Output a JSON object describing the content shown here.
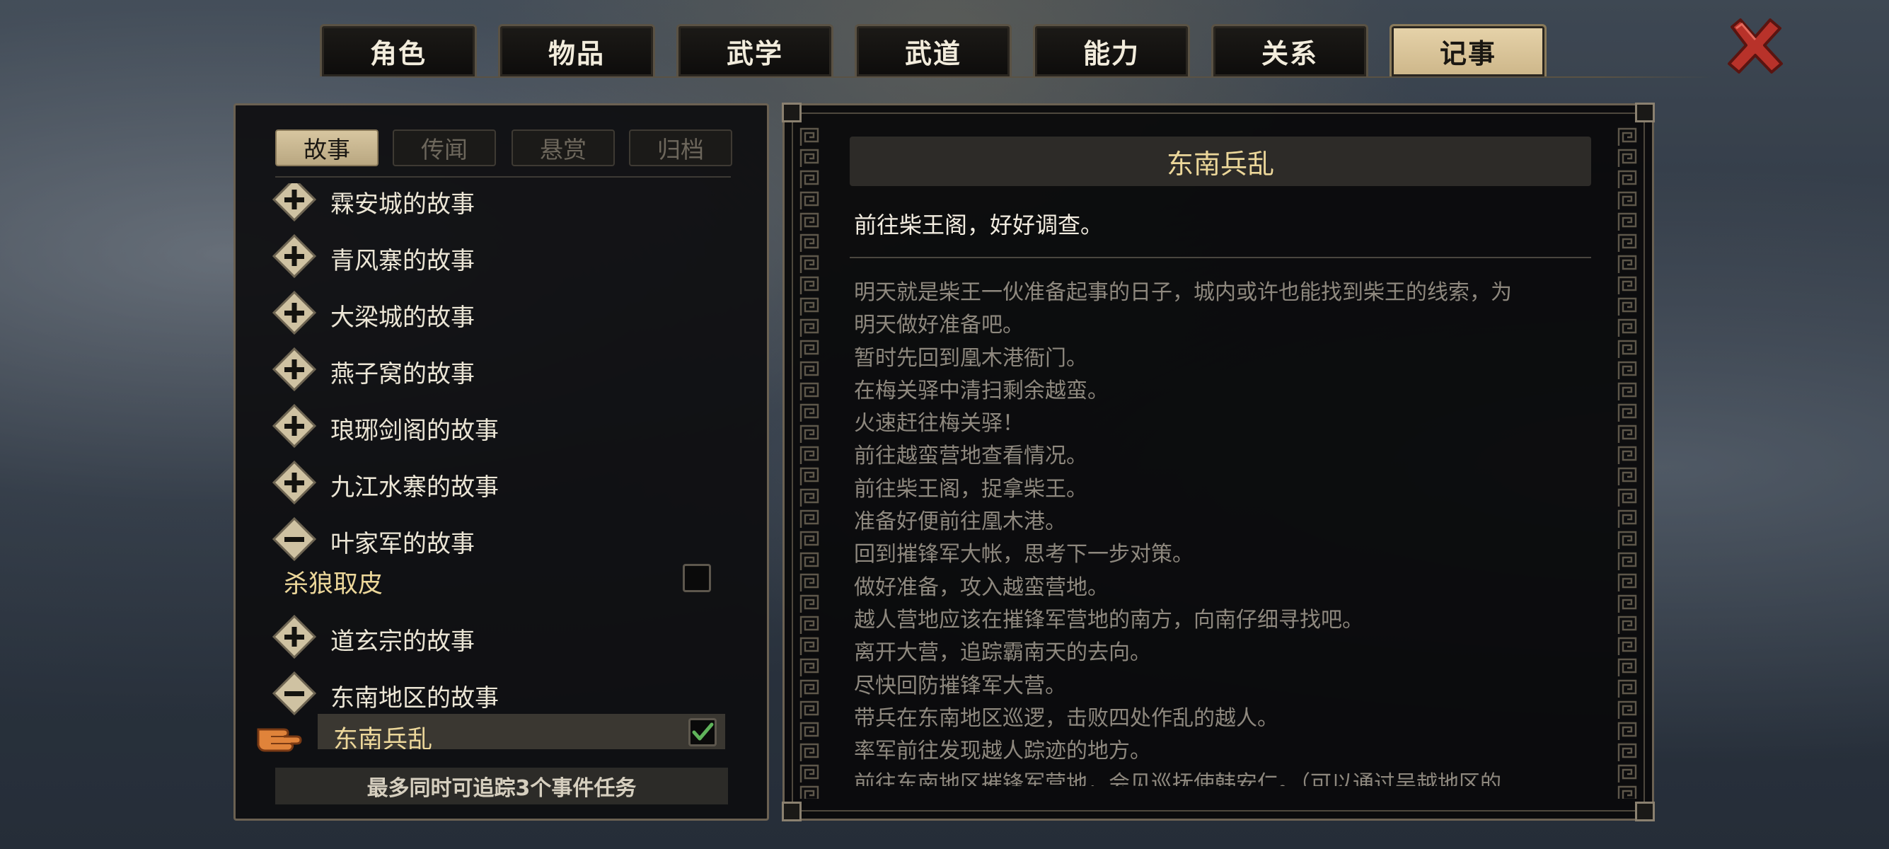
{
  "tabs": [
    {
      "label": "角色",
      "active": false
    },
    {
      "label": "物品",
      "active": false
    },
    {
      "label": "武学",
      "active": false
    },
    {
      "label": "武道",
      "active": false
    },
    {
      "label": "能力",
      "active": false
    },
    {
      "label": "关系",
      "active": false
    },
    {
      "label": "记事",
      "active": true
    }
  ],
  "subtabs": [
    {
      "label": "故事",
      "active": true
    },
    {
      "label": "传闻",
      "active": false
    },
    {
      "label": "悬赏",
      "active": false
    },
    {
      "label": "归档",
      "active": false
    }
  ],
  "stories": [
    {
      "label": "霖安城的故事",
      "expanded": false
    },
    {
      "label": "青风寨的故事",
      "expanded": false
    },
    {
      "label": "大梁城的故事",
      "expanded": false
    },
    {
      "label": "燕子窝的故事",
      "expanded": false
    },
    {
      "label": "琅琊剑阁的故事",
      "expanded": false
    },
    {
      "label": "九江水寨的故事",
      "expanded": false
    },
    {
      "label": "叶家军的故事",
      "expanded": true
    },
    {
      "label": "道玄宗的故事",
      "expanded": false
    },
    {
      "label": "东南地区的故事",
      "expanded": true
    }
  ],
  "quests": [
    {
      "label": "杀狼取皮",
      "tracked": false
    },
    {
      "label": "东南兵乱",
      "tracked": true
    }
  ],
  "footer_note": "最多同时可追踪3个事件任务",
  "detail": {
    "title": "东南兵乱",
    "current_goal": "前往柴王阁，好好调查。",
    "history": [
      "明天就是柴王一伙准备起事的日子，城内或许也能找到柴王的线索，为",
      "明天做好准备吧。",
      "暂时先回到凰木港衙门。",
      "在梅关驿中清扫剩余越蛮。",
      "火速赶往梅关驿！",
      "前往越蛮营地查看情况。",
      "前往柴王阁，捉拿柴王。",
      "准备好便前往凰木港。",
      "回到摧锋军大帐，思考下一步对策。",
      "做好准备，攻入越蛮营地。",
      "越人营地应该在摧锋军营地的南方，向南仔细寻找吧。",
      "离开大营，追踪霸南天的去向。",
      "尽快回防摧锋军大营。",
      "带兵在东南地区巡逻，击败四处作乱的越人。",
      "率军前往发现越人踪迹的地方。",
      "前往东南地区摧锋军营地，会见巡抚使韩安仁。（可以通过吴越地区的"
    ]
  },
  "colors": {
    "accent_gold": "#ecd79a",
    "active_tab": "#d8c49c",
    "check_green": "#5fb35a",
    "close_red": "#c0392b"
  }
}
